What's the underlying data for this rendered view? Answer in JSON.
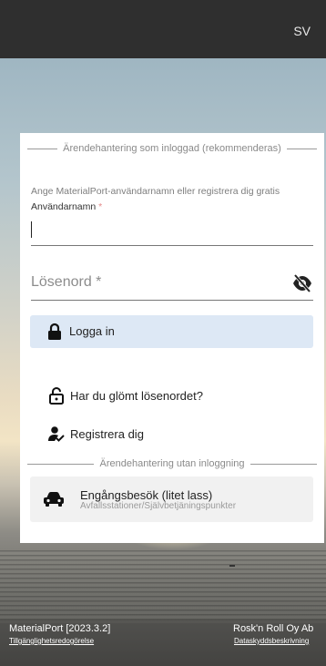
{
  "topbar": {
    "language": "SV"
  },
  "card": {
    "logged_in_legend": "Ärendehantering som inloggad (rekommenderas)",
    "hint": "Ange MaterialPort-användarnamn eller registrera dig gratis",
    "username_label": "Användarnamn",
    "required_mark": "*",
    "username_value": "",
    "password_label": "Lösenord *",
    "login_label": "Logga in",
    "forgot_label": "Har du glömt lösenordet?",
    "register_label": "Registrera dig",
    "guest_legend": "Ärendehantering utan inloggning",
    "single_visit_label": "Engångsbesök (litet lass)",
    "single_visit_sub": "Avfallsstationer/Självbetjäningspunkter"
  },
  "footer": {
    "app_version": "MaterialPort [2023.3.2]",
    "accessibility_link": "Tillgänglighetsredogörelse",
    "company": "Rosk'n Roll Oy Ab",
    "privacy_link": "Dataskyddsbeskrivning"
  },
  "icons": {
    "eye": "eye-off-icon",
    "login": "lock-icon",
    "forgot": "lock-open-icon",
    "register": "person-check-icon",
    "visit": "car-icon"
  },
  "colors": {
    "topbar": "#2f2f2f",
    "login_button": "#dde8f5",
    "required": "#e58a8a"
  }
}
